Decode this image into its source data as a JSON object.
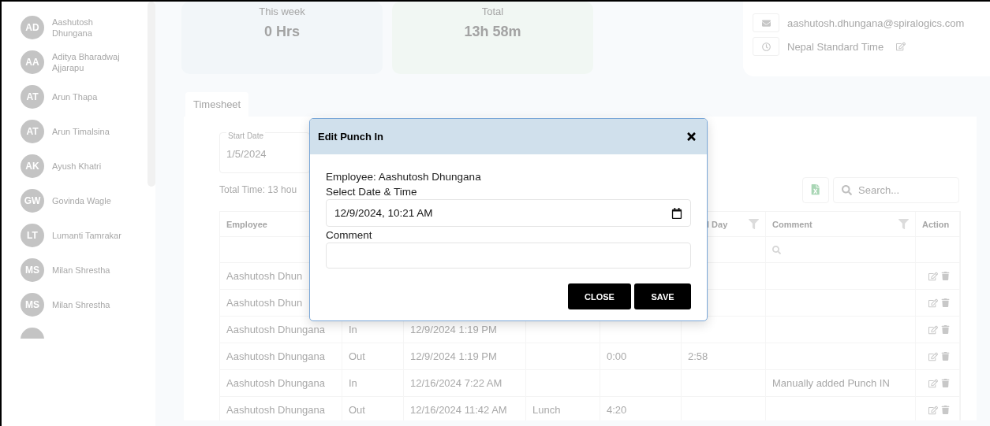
{
  "sidebar": {
    "items": [
      {
        "initials": "AD",
        "name": "Aashutosh Dhungana"
      },
      {
        "initials": "AA",
        "name": "Aditya Bharadwaj Ajjarapu"
      },
      {
        "initials": "AT",
        "name": "Arun Thapa"
      },
      {
        "initials": "AT",
        "name": "Arun Timalsina"
      },
      {
        "initials": "AK",
        "name": "Ayush Khatri"
      },
      {
        "initials": "GW",
        "name": "Govinda Wagle"
      },
      {
        "initials": "LT",
        "name": "Lumanti Tamrakar"
      },
      {
        "initials": "MS",
        "name": "Milan Shrestha"
      },
      {
        "initials": "MS",
        "name": "Milan Shrestha"
      }
    ],
    "more_below": true
  },
  "stats": [
    {
      "label": "This week",
      "value": "0 Hrs",
      "color": "#f2f6f9"
    },
    {
      "label": "Total",
      "value": "13h 58m",
      "color": "#f1f7f3"
    }
  ],
  "profile": {
    "rows": [
      {
        "kind": "email",
        "text": "aashutosh.dhungana@spiralogics.com",
        "editable": false
      },
      {
        "kind": "timezone",
        "text": "Nepal Standard Time",
        "editable": true
      }
    ]
  },
  "tabs": [
    {
      "label": "Timesheet",
      "selected": true
    }
  ],
  "start_date": {
    "label": "Start Date",
    "value": "1/5/2024"
  },
  "total_time": "Total Time: 13 hou",
  "search": {
    "placeholder": "Search..."
  },
  "table": {
    "columns": [
      {
        "label": "Employee",
        "filter": false
      },
      {},
      {},
      {},
      {},
      {
        "label": "l Day",
        "filter": true
      },
      {
        "label": "Comment",
        "filter": true,
        "search": true
      },
      {
        "label": "Action",
        "filter": false
      }
    ],
    "rows": [
      {
        "cells": [
          "Aashutosh Dhun",
          null,
          null,
          null,
          null,
          null,
          null
        ]
      },
      {
        "cells": [
          "Aashutosh Dhun",
          null,
          null,
          null,
          null,
          null,
          null
        ]
      },
      {
        "cells": [
          "Aashutosh Dhungana",
          "In",
          "12/9/2024 1:19 PM",
          null,
          null,
          null,
          null
        ]
      },
      {
        "cells": [
          "Aashutosh Dhungana",
          "Out",
          "12/9/2024 1:19 PM",
          null,
          "0:00",
          "2:58",
          null
        ]
      },
      {
        "cells": [
          "Aashutosh Dhungana",
          "In",
          "12/16/2024 7:22 AM",
          null,
          null,
          null,
          "Manually added Punch IN"
        ]
      },
      {
        "cells": [
          "Aashutosh Dhungana",
          "Out",
          "12/16/2024 11:42 AM",
          "Lunch",
          "4:20",
          null,
          null
        ]
      }
    ]
  },
  "modal": {
    "title": "Edit Punch In",
    "employee": "Employee: Aashutosh Dhungana",
    "date_label": "Select Date & Time",
    "date_value": "12/9/2024, 10:21 AM",
    "comment_label": "Comment",
    "buttons": [
      "CLOSE",
      "SAVE"
    ]
  }
}
